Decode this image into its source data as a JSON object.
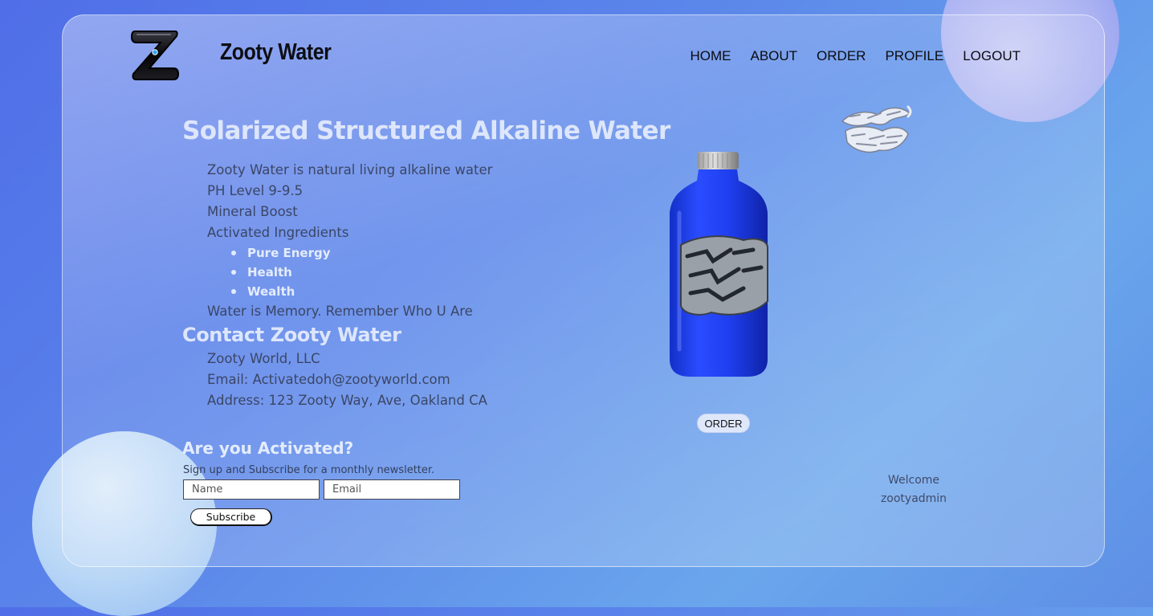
{
  "brand": {
    "name": "Zooty Water",
    "logo_icon": "z-logo-icon"
  },
  "nav": {
    "items": [
      "HOME",
      "ABOUT",
      "ORDER",
      "PROFILE",
      "LOGOUT"
    ]
  },
  "hero": {
    "title": "Solarized Structured Alkaline Water",
    "lines": [
      "Zooty Water is natural living alkaline water",
      "PH Level 9-9.5",
      "Mineral Boost",
      "Activated Ingredients"
    ],
    "ingredients": [
      "Pure Energy",
      "Health",
      "Wealth"
    ],
    "closing": "Water is Memory. Remember Who U Are"
  },
  "contact": {
    "title": "Contact Zooty Water",
    "company": "Zooty World, LLC",
    "email": "Email: Activatedoh@zootyworld.com",
    "address": "Address: 123 Zooty Way, Ave, Oakland CA"
  },
  "newsletter": {
    "title": "Are you Activated?",
    "text": "Sign up and Subscribe for a monthly newsletter.",
    "name_placeholder": "Name",
    "email_placeholder": "Email",
    "subscribe_label": "Subscribe"
  },
  "product": {
    "script_logo": "ZOOTY WATER",
    "bottle_label": "ZOOTY WATER",
    "order_label": "ORDER",
    "bottle_color": "#1f3ff0"
  },
  "user": {
    "welcome": "Welcome",
    "username": "zootyadmin"
  }
}
